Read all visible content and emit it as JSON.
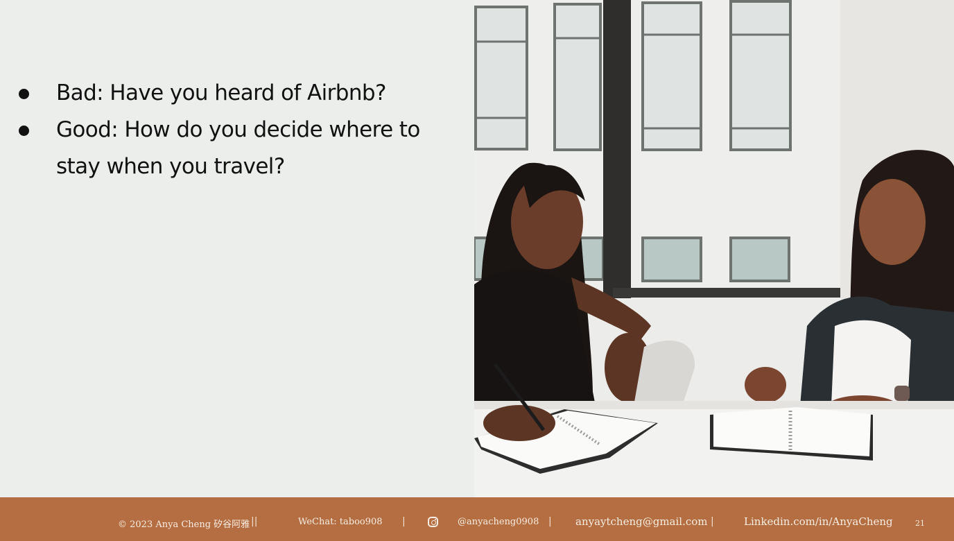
{
  "slide": {
    "bullets": [
      "Bad: Have you heard of Airbnb?",
      "Good: How do you decide where to stay when you travel?"
    ]
  },
  "footer": {
    "copyright": "© 2023 Anya Cheng 矽谷阿雅",
    "wechat": "WeChat: taboo908",
    "instagram": "@anyacheng0908",
    "email": "anyaytcheng@gmail.com",
    "linkedin": "Linkedin.com/in/AnyaCheng",
    "page_number": "21",
    "separator": "||",
    "separator_single": "|"
  },
  "colors": {
    "slide_background": "#eceeec",
    "footer_background": "#b46e41",
    "footer_text": "#f8ede4"
  }
}
